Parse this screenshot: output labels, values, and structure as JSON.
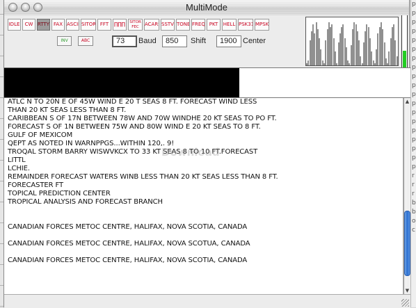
{
  "window": {
    "title": "MultiMode"
  },
  "modes": [
    {
      "id": "idle",
      "label": "IDLE",
      "lines": 1
    },
    {
      "id": "cw",
      "label": "CW",
      "lines": 1
    },
    {
      "id": "rtty",
      "label": "RTTY",
      "lines": 1,
      "active": true
    },
    {
      "id": "fax",
      "label": "FAX",
      "lines": 1
    },
    {
      "id": "ascii",
      "label": "ASCII",
      "lines": 1
    },
    {
      "id": "sitor",
      "label": "SITOR",
      "lines": 1
    },
    {
      "id": "fft",
      "label": "FFT",
      "lines": 1
    },
    {
      "id": "pulse",
      "label": "∏∏∏",
      "lines": 1
    },
    {
      "id": "sitor-fec",
      "label": "SITOR FEC",
      "lines": 2
    },
    {
      "id": "acars",
      "label": "ACARS",
      "lines": 1
    },
    {
      "id": "sstv",
      "label": "SSTV",
      "lines": 1
    },
    {
      "id": "tone",
      "label": "TONE",
      "lines": 1
    },
    {
      "id": "freq",
      "label": "FREQ",
      "lines": 1
    },
    {
      "id": "pkt",
      "label": "PKT",
      "lines": 1
    },
    {
      "id": "hell",
      "label": "HELL",
      "lines": 1
    },
    {
      "id": "psk31",
      "label": "PSK31",
      "lines": 1
    },
    {
      "id": "mpsk",
      "label": "MPSK",
      "lines": 1
    }
  ],
  "toggles": {
    "inv": "INV",
    "abc": "ABC"
  },
  "settings": {
    "baud_value": "73",
    "baud_label": "Baud",
    "shift_value": "850",
    "shift_label": "Shift",
    "center_value": "1900",
    "center_label": "Center"
  },
  "signal_level": 0.32,
  "spectrum_bars": [
    0.05,
    0.1,
    0.55,
    0.75,
    0.9,
    0.7,
    0.95,
    0.8,
    0.6,
    0.35,
    0.1,
    0.05,
    0.55,
    0.8,
    0.95,
    0.85,
    0.9,
    0.6,
    0.3,
    0.05,
    0.5,
    0.7,
    0.85,
    0.9,
    0.6,
    0.4,
    0.1,
    0.05,
    0.45,
    0.8,
    0.95,
    0.9,
    0.75,
    0.55,
    0.2,
    0.05,
    0.5,
    0.75,
    0.9,
    0.85,
    0.6,
    0.3,
    0.1,
    0.05,
    0.35,
    0.7,
    0.85,
    0.95,
    0.8,
    0.5,
    0.15,
    0.04,
    0.3,
    0.6,
    0.85,
    0.9,
    0.55,
    0.2
  ],
  "text_lines": [
    "ATLC N TO 20N E OF 45W WIND E 20 T SEAS 8 FT. FORECAST WIND LESS",
    "THAN 20 KT SEAS LESS THAN 8 FT.",
    "CARIBBEAN S OF 17N BETWEEN 78W AND 70W WINDHE 20 KT SEAS TO PO FT.",
    "FORECAST S OF 1N BETWEEN 75W AND 80W WIND E 20 KT SEAS TO 8 FT.",
    "GULF OF MEXICOM",
    "QEPT AS NOTED IN WARNPPGS...WITHIN 120,. 9!",
    "TROQAL STORM BARRY WISWVKCX TO 33 KT SEAS 8 TO 10 FT.FORECAST",
    "LITTL",
    "LCHIE.",
    "REMAINDER FORECAST WATERS WINB LESS THAN 20 KT SEAS LESS THAN 8 FT.",
    "FORECASTER FT",
    "TOPICAL PREDICTION CENTER",
    "TROPICAL ANALYSIS AND FORECAST BRANCH",
    "",
    "",
    "CANADIAN FORCES METOC CENTRE, HALIFAX, NOVA SCOTIA, CANADA",
    "",
    "CANADIAN FORCES METOC CENTRE, HALIFAX, NOVA SCOTUA, CANADA",
    "",
    "CANADIAN FORCES METOC CENTRE, HALIFAX, NOVA SCOTIA, CANADA"
  ],
  "scrollbar": {
    "up": "▲",
    "down": "▼",
    "thumb_start": 0.58,
    "thumb_size": 0.36
  },
  "watermark": "Download",
  "colors": {
    "mode_text": "#c8001e",
    "level_fill": "#22cc22",
    "scrollbar_thumb": "#2b6fd1"
  },
  "background": {
    "right_letters": [
      "p",
      "p",
      "p",
      "p",
      "p",
      "p",
      "p",
      "p",
      "p",
      "p",
      "p",
      "p",
      "p",
      "p",
      "p",
      "p",
      "p",
      "p",
      "p",
      "r",
      "r",
      "r",
      "b",
      "b",
      "o",
      "c"
    ]
  }
}
